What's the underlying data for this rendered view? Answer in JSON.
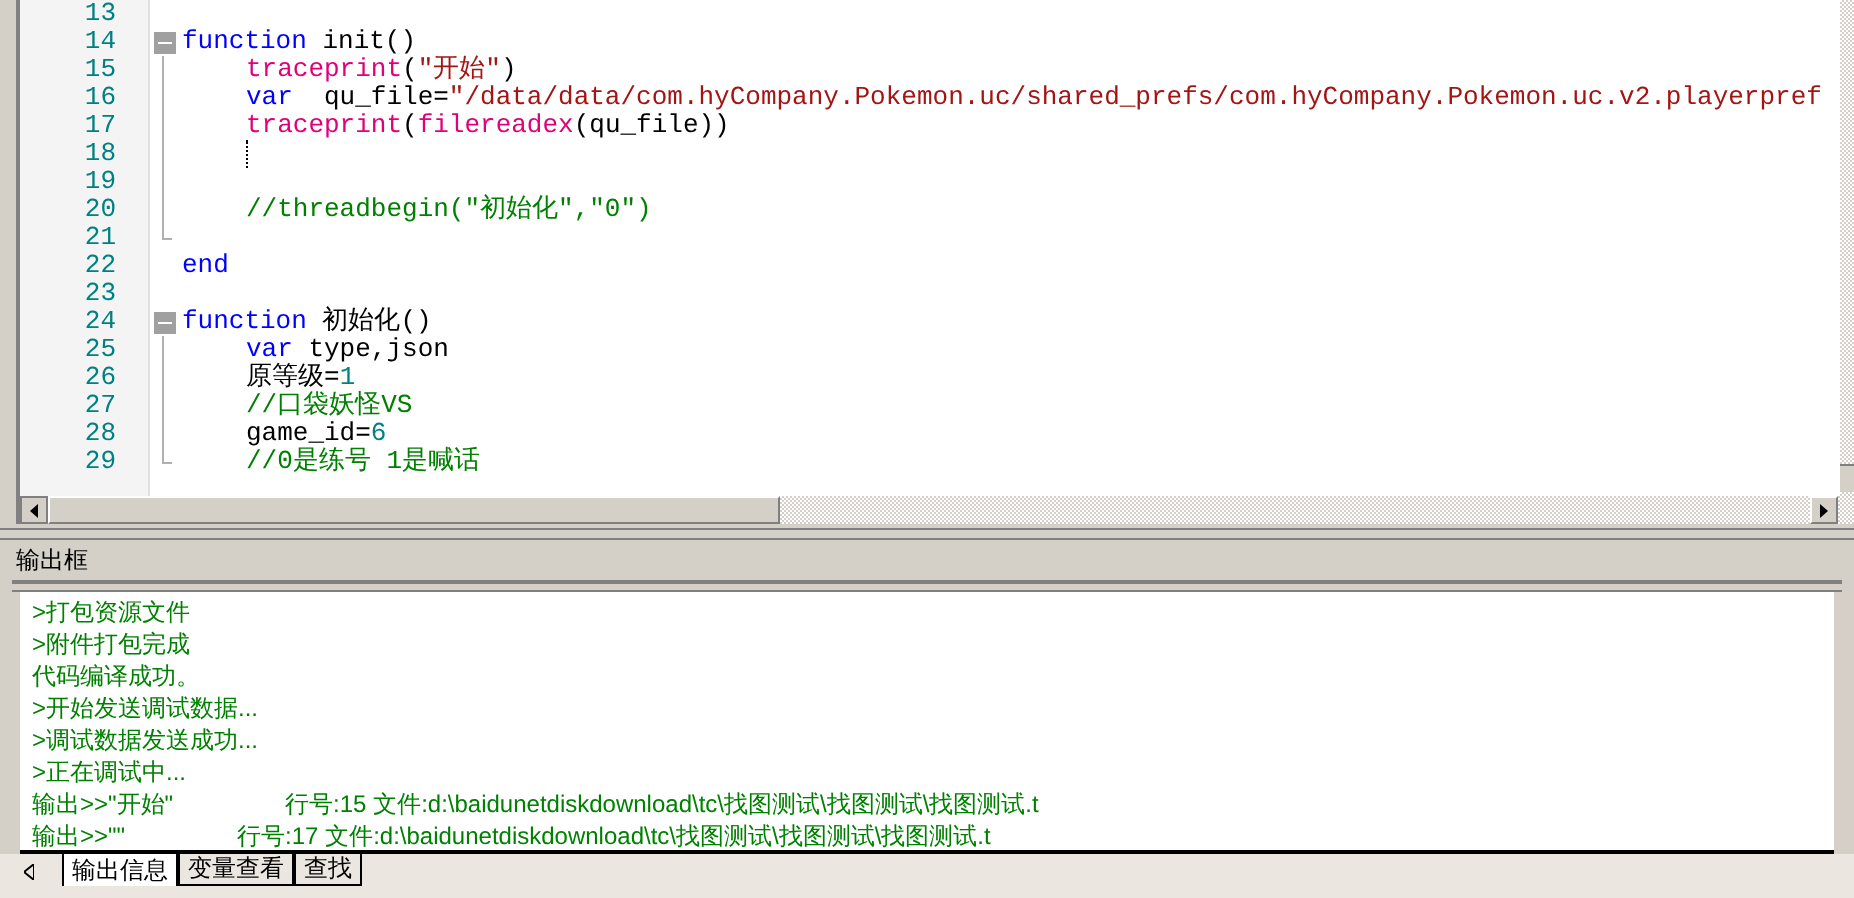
{
  "editor": {
    "lines": [
      {
        "number": "13"
      },
      {
        "number": "14",
        "expanded": true,
        "tokens": [
          {
            "kind": "keyword",
            "text": "function"
          },
          {
            "kind": "plain",
            "text": " init()"
          }
        ],
        "children": [
          {
            "number": "15",
            "tokens": [
              {
                "kind": "func",
                "text": "traceprint"
              },
              {
                "kind": "plain",
                "text": "("
              },
              {
                "kind": "string",
                "text": "\"开始\""
              },
              {
                "kind": "plain",
                "text": ")"
              }
            ]
          },
          {
            "number": "16",
            "tokens": [
              {
                "kind": "keyword",
                "text": "var"
              },
              {
                "kind": "plain",
                "text": "  qu_file="
              },
              {
                "kind": "string",
                "text": "\"/data/data/com.hyCompany.Pokemon.uc/shared_prefs/com.hyCompany.Pokemon.uc.v2.playerpref"
              }
            ]
          },
          {
            "number": "17",
            "tokens": [
              {
                "kind": "func",
                "text": "traceprint"
              },
              {
                "kind": "plain",
                "text": "("
              },
              {
                "kind": "func",
                "text": "filereadex"
              },
              {
                "kind": "plain",
                "text": "(qu_file))"
              }
            ]
          },
          {
            "number": "18",
            "caret": true
          },
          {
            "number": "19"
          },
          {
            "number": "20",
            "tokens": [
              {
                "kind": "comment",
                "text": "//threadbegin(\"初始化\",\"0\")"
              }
            ]
          },
          {
            "number": "21"
          }
        ]
      },
      {
        "number": "22",
        "tokens": [
          {
            "kind": "keyword",
            "text": "end"
          }
        ]
      },
      {
        "number": "23"
      },
      {
        "number": "24",
        "expanded": true,
        "tokens": [
          {
            "kind": "keyword",
            "text": "function"
          },
          {
            "kind": "plain",
            "text": " 初始化()"
          }
        ],
        "children": [
          {
            "number": "25",
            "tokens": [
              {
                "kind": "keyword",
                "text": "var"
              },
              {
                "kind": "plain",
                "text": " type,json"
              }
            ]
          },
          {
            "number": "26",
            "tokens": [
              {
                "kind": "plain",
                "text": "原等级="
              },
              {
                "kind": "number",
                "text": "1"
              }
            ]
          },
          {
            "number": "27",
            "tokens": [
              {
                "kind": "comment",
                "text": "//口袋妖怪VS"
              }
            ]
          },
          {
            "number": "28",
            "tokens": [
              {
                "kind": "plain",
                "text": "game_id="
              },
              {
                "kind": "number",
                "text": "6"
              }
            ]
          },
          {
            "number": "29",
            "tokens": [
              {
                "kind": "comment",
                "text": "//0是练号 1是喊话"
              }
            ]
          }
        ]
      }
    ]
  },
  "output_panel": {
    "title": "输出框",
    "lines": [
      {
        "text": ">打包资源文件"
      },
      {
        "text": ">附件打包完成"
      },
      {
        "text": "代码编译成功。"
      },
      {
        "text": ">开始发送调试数据..."
      },
      {
        "text": ">调试数据发送成功..."
      },
      {
        "text": ">正在调试中..."
      },
      {
        "text": "输出>>\"开始\"",
        "location": "行号:15 文件:d:\\baidunetdiskdownload\\tc\\找图测试\\找图测试\\找图测试.t"
      },
      {
        "text": "输出>>\"\"",
        "location": "行号:17 文件:d:\\baidunetdiskdownload\\tc\\找图测试\\找图测试\\找图测试.t"
      }
    ]
  },
  "tabs": [
    {
      "label": "输出信息",
      "selected": true
    },
    {
      "label": "变量查看",
      "selected": false
    },
    {
      "label": "查找",
      "selected": false
    }
  ]
}
